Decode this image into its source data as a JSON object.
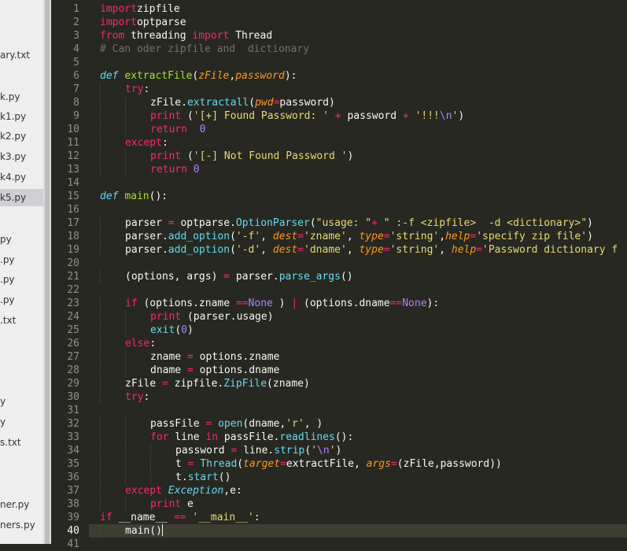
{
  "sidebar": {
    "files": [
      {
        "label": "ary.txt",
        "active": false
      },
      {
        "label": "k.py",
        "active": false
      },
      {
        "label": "k1.py",
        "active": false
      },
      {
        "label": "k2.py",
        "active": false
      },
      {
        "label": "k3.py",
        "active": false
      },
      {
        "label": "k4.py",
        "active": false
      },
      {
        "label": "k5.py",
        "active": true
      },
      {
        "label": "py",
        "active": false
      },
      {
        "label": ".py",
        "active": false
      },
      {
        "label": ".py",
        "active": false
      },
      {
        "label": ".py",
        "active": false
      },
      {
        "label": ".txt",
        "active": false
      },
      {
        "label": "y",
        "active": false
      },
      {
        "label": "y",
        "active": false
      },
      {
        "label": "s.txt",
        "active": false
      },
      {
        "label": "ner.py",
        "active": false
      },
      {
        "label": "ners.py",
        "active": false
      }
    ]
  },
  "editor": {
    "current_line": 40,
    "lines": [
      {
        "n": "1",
        "i": 0,
        "t": [
          [
            "kw",
            "import"
          ],
          [
            "",
            "zipfile"
          ]
        ]
      },
      {
        "n": "2",
        "i": 0,
        "t": [
          [
            "kw",
            "import"
          ],
          [
            "",
            "optparse"
          ]
        ]
      },
      {
        "n": "3",
        "i": 0,
        "t": [
          [
            "kw",
            "from"
          ],
          [
            "",
            " threading "
          ],
          [
            "kw",
            "import"
          ],
          [
            "",
            " Thread"
          ]
        ]
      },
      {
        "n": "4",
        "i": 0,
        "t": [
          [
            "cm",
            "# Can oder zipfile and  dictionary"
          ]
        ]
      },
      {
        "n": "5",
        "i": 0,
        "t": []
      },
      {
        "n": "6",
        "i": 0,
        "t": [
          [
            "df",
            "def "
          ],
          [
            "fn",
            "extractFile"
          ],
          [
            "",
            "("
          ],
          [
            "pa",
            "zFile"
          ],
          [
            "",
            ","
          ],
          [
            "pa",
            "password"
          ],
          [
            "",
            "):"
          ]
        ]
      },
      {
        "n": "7",
        "i": 1,
        "t": [
          [
            "kw",
            "try"
          ],
          [
            "",
            ":"
          ]
        ]
      },
      {
        "n": "8",
        "i": 2,
        "t": [
          [
            "",
            "zFile."
          ],
          [
            "sp",
            "extractall"
          ],
          [
            "",
            "("
          ],
          [
            "pa",
            "pwd"
          ],
          [
            "kw",
            "="
          ],
          [
            "",
            "password)"
          ]
        ]
      },
      {
        "n": "9",
        "i": 2,
        "t": [
          [
            "kw",
            "print"
          ],
          [
            "",
            " ("
          ],
          [
            "st",
            "'[+] Found Password: '"
          ],
          [
            "kw",
            " + "
          ],
          [
            "",
            "password"
          ],
          [
            "kw",
            " + "
          ],
          [
            "st",
            "'!!!"
          ],
          [
            "nu",
            "\\n"
          ],
          [
            "st",
            "'"
          ],
          [
            "",
            ")"
          ]
        ]
      },
      {
        "n": "10",
        "i": 2,
        "t": [
          [
            "kw",
            "return"
          ],
          [
            "nu",
            "  0"
          ]
        ]
      },
      {
        "n": "11",
        "i": 1,
        "t": [
          [
            "kw",
            "except"
          ],
          [
            "",
            ":"
          ]
        ]
      },
      {
        "n": "12",
        "i": 2,
        "t": [
          [
            "kw",
            "print"
          ],
          [
            "",
            " ("
          ],
          [
            "st",
            "'[-] Not Found Password '"
          ],
          [
            "",
            ")"
          ]
        ]
      },
      {
        "n": "13",
        "i": 2,
        "t": [
          [
            "kw",
            "return"
          ],
          [
            "nu",
            " 0"
          ]
        ]
      },
      {
        "n": "14",
        "i": 0,
        "t": []
      },
      {
        "n": "15",
        "i": 0,
        "t": [
          [
            "df",
            "def "
          ],
          [
            "fn",
            "main"
          ],
          [
            "",
            "():"
          ]
        ]
      },
      {
        "n": "16",
        "i": 0,
        "t": []
      },
      {
        "n": "17",
        "i": 1,
        "t": [
          [
            "",
            "parser "
          ],
          [
            "kw",
            "="
          ],
          [
            "",
            " optparse."
          ],
          [
            "sp",
            "OptionParser"
          ],
          [
            "",
            "("
          ],
          [
            "st",
            "\"usage: \""
          ],
          [
            "kw",
            "+"
          ],
          [
            "st",
            " \" :-f <zipfile>  -d <dictionary>\""
          ],
          [
            "",
            ")"
          ]
        ]
      },
      {
        "n": "18",
        "i": 1,
        "t": [
          [
            "",
            "parser."
          ],
          [
            "sp",
            "add_option"
          ],
          [
            "",
            "("
          ],
          [
            "st",
            "'-f'"
          ],
          [
            "",
            ", "
          ],
          [
            "pa",
            "dest"
          ],
          [
            "kw",
            "="
          ],
          [
            "st",
            "'zname'"
          ],
          [
            "",
            ", "
          ],
          [
            "pa",
            "type"
          ],
          [
            "kw",
            "="
          ],
          [
            "st",
            "'string'"
          ],
          [
            "",
            ","
          ],
          [
            "pa",
            "help"
          ],
          [
            "kw",
            "="
          ],
          [
            "st",
            "'specify zip file'"
          ],
          [
            "",
            ")"
          ]
        ]
      },
      {
        "n": "19",
        "i": 1,
        "t": [
          [
            "",
            "parser."
          ],
          [
            "sp",
            "add_option"
          ],
          [
            "",
            "("
          ],
          [
            "st",
            "'-d'"
          ],
          [
            "",
            ", "
          ],
          [
            "pa",
            "dest"
          ],
          [
            "kw",
            "="
          ],
          [
            "st",
            "'dname'"
          ],
          [
            "",
            ", "
          ],
          [
            "pa",
            "type"
          ],
          [
            "kw",
            "="
          ],
          [
            "st",
            "'string'"
          ],
          [
            "",
            ", "
          ],
          [
            "pa",
            "help"
          ],
          [
            "kw",
            "="
          ],
          [
            "st",
            "'Password dictionary f"
          ]
        ]
      },
      {
        "n": "20",
        "i": 0,
        "t": []
      },
      {
        "n": "21",
        "i": 1,
        "t": [
          [
            "",
            "(options, args) "
          ],
          [
            "kw",
            "="
          ],
          [
            "",
            " parser."
          ],
          [
            "sp",
            "parse_args"
          ],
          [
            "",
            "()"
          ]
        ]
      },
      {
        "n": "22",
        "i": 0,
        "t": []
      },
      {
        "n": "23",
        "i": 1,
        "t": [
          [
            "kw",
            "if"
          ],
          [
            "",
            " (options.zname "
          ],
          [
            "kw",
            "=="
          ],
          [
            "nu",
            "None"
          ],
          [
            "",
            " ) "
          ],
          [
            "kw",
            "|"
          ],
          [
            "",
            " (options.dname"
          ],
          [
            "kw",
            "=="
          ],
          [
            "nu",
            "None"
          ],
          [
            "",
            "):"
          ]
        ]
      },
      {
        "n": "24",
        "i": 2,
        "t": [
          [
            "kw",
            "print"
          ],
          [
            "",
            " (parser.usage)"
          ]
        ]
      },
      {
        "n": "25",
        "i": 2,
        "t": [
          [
            "bi",
            "exit"
          ],
          [
            "",
            "("
          ],
          [
            "nu",
            "0"
          ],
          [
            "",
            ")"
          ]
        ]
      },
      {
        "n": "26",
        "i": 1,
        "t": [
          [
            "kw",
            "else"
          ],
          [
            "",
            ":"
          ]
        ]
      },
      {
        "n": "27",
        "i": 2,
        "t": [
          [
            "",
            "zname "
          ],
          [
            "kw",
            "="
          ],
          [
            "",
            " options.zname"
          ]
        ]
      },
      {
        "n": "28",
        "i": 2,
        "t": [
          [
            "",
            "dname "
          ],
          [
            "kw",
            "="
          ],
          [
            "",
            " options.dname"
          ]
        ]
      },
      {
        "n": "29",
        "i": 1,
        "t": [
          [
            "",
            "zFile "
          ],
          [
            "kw",
            "="
          ],
          [
            "",
            " zipfile."
          ],
          [
            "sp",
            "ZipFile"
          ],
          [
            "",
            "(zname)"
          ]
        ]
      },
      {
        "n": "30",
        "i": 1,
        "t": [
          [
            "kw",
            "try"
          ],
          [
            "",
            ":"
          ]
        ]
      },
      {
        "n": "31",
        "i": 0,
        "t": []
      },
      {
        "n": "32",
        "i": 2,
        "t": [
          [
            "",
            "passFile "
          ],
          [
            "kw",
            "="
          ],
          [
            "",
            " "
          ],
          [
            "bi",
            "open"
          ],
          [
            "",
            "(dname,"
          ],
          [
            "st",
            "'r'"
          ],
          [
            "",
            ", )"
          ]
        ]
      },
      {
        "n": "33",
        "i": 2,
        "t": [
          [
            "kw",
            "for"
          ],
          [
            "",
            " line "
          ],
          [
            "kw",
            "in"
          ],
          [
            "",
            " passFile."
          ],
          [
            "sp",
            "readlines"
          ],
          [
            "",
            "():"
          ]
        ]
      },
      {
        "n": "34",
        "i": 3,
        "t": [
          [
            "",
            "password "
          ],
          [
            "kw",
            "="
          ],
          [
            "",
            " line."
          ],
          [
            "sp",
            "strip"
          ],
          [
            "",
            "("
          ],
          [
            "st",
            "'"
          ],
          [
            "nu",
            "\\n"
          ],
          [
            "st",
            "'"
          ],
          [
            "",
            ")"
          ]
        ]
      },
      {
        "n": "35",
        "i": 3,
        "t": [
          [
            "",
            "t "
          ],
          [
            "kw",
            "="
          ],
          [
            "",
            " "
          ],
          [
            "sp",
            "Thread"
          ],
          [
            "",
            "("
          ],
          [
            "pa",
            "target"
          ],
          [
            "kw",
            "="
          ],
          [
            "",
            "extractFile, "
          ],
          [
            "pa",
            "args"
          ],
          [
            "kw",
            "="
          ],
          [
            "",
            "(zFile,password))"
          ]
        ]
      },
      {
        "n": "36",
        "i": 3,
        "t": [
          [
            "",
            "t."
          ],
          [
            "sp",
            "start"
          ],
          [
            "",
            "()"
          ]
        ]
      },
      {
        "n": "37",
        "i": 1,
        "t": [
          [
            "kw",
            "except"
          ],
          [
            "",
            " "
          ],
          [
            "ex",
            "Exception"
          ],
          [
            "",
            ",e:"
          ]
        ]
      },
      {
        "n": "38",
        "i": 2,
        "t": [
          [
            "kw",
            "print"
          ],
          [
            "",
            " e"
          ]
        ]
      },
      {
        "n": "39",
        "i": 0,
        "t": [
          [
            "kw",
            "if"
          ],
          [
            "",
            " __name__ "
          ],
          [
            "kw",
            "=="
          ],
          [
            "",
            " "
          ],
          [
            "st",
            "'__main__'"
          ],
          [
            "",
            ":"
          ]
        ]
      },
      {
        "n": "40",
        "i": 1,
        "t": [
          [
            "",
            "main()"
          ]
        ]
      },
      {
        "n": "41",
        "i": 0,
        "t": []
      }
    ]
  }
}
